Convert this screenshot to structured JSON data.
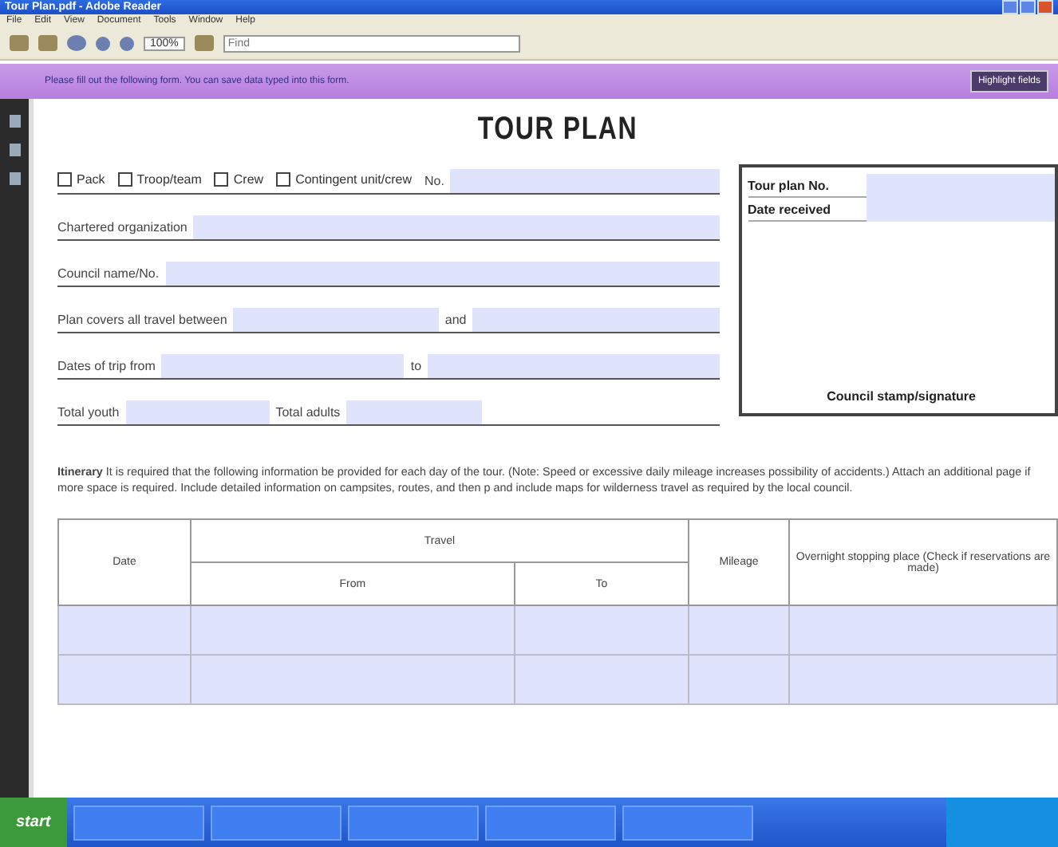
{
  "window": {
    "title": "Tour Plan.pdf - Adobe Reader"
  },
  "menu": [
    "File",
    "Edit",
    "View",
    "Document",
    "Tools",
    "Window",
    "Help"
  ],
  "toolbar": {
    "zoom": "100%",
    "find_placeholder": "Find"
  },
  "document_message": {
    "text": "Please fill out the following form. You can save data typed into this form.",
    "button": "Highlight fields"
  },
  "form": {
    "title": "TOUR PLAN",
    "unit_types": [
      {
        "label": "Pack",
        "checked": false
      },
      {
        "label": "Troop/team",
        "checked": false
      },
      {
        "label": "Crew",
        "checked": false
      },
      {
        "label": "Contingent unit/crew",
        "checked": false
      }
    ],
    "unit_number_label": "No.",
    "chartered_org_label": "Chartered organization",
    "council_label": "Council name/No.",
    "travel_between_label": "Plan covers all travel between",
    "and_label": "and",
    "dates_from_label": "Dates of trip from",
    "dates_to_label": "to",
    "total_youth_label": "Total youth",
    "total_adults_label": "Total adults",
    "office_box": {
      "plan_no_label": "Tour plan No.",
      "date_received_label": "Date received",
      "stamp_label": "Council stamp/signature"
    },
    "itinerary": "**Itinerary** It is required that the following information be provided for each day of the tour. (Note: Speed or excessive daily mileage increases possibility of accidents.) Attach an additional page if more space is required. Include detailed information on campsites, routes, and then p and include maps for wilderness travel as required by the local council.",
    "table": {
      "date": "Date",
      "travel": "Travel",
      "from": "From",
      "to": "To",
      "mileage": "Mileage",
      "overnight": "Overnight stopping place (Check if reservations are made)"
    }
  },
  "taskbar": {
    "start": "start"
  }
}
